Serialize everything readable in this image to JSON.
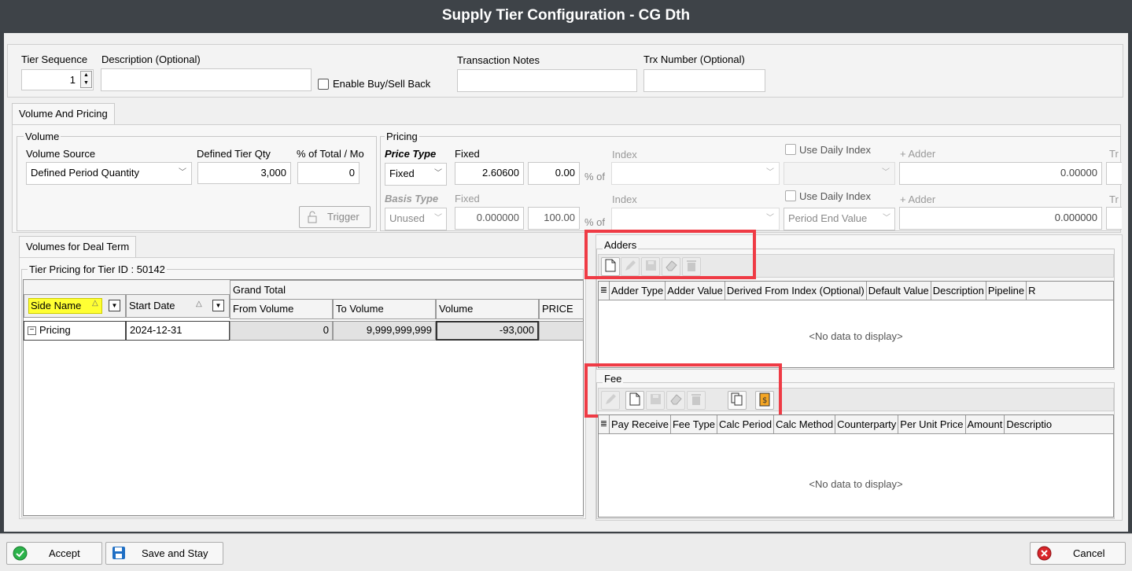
{
  "window": {
    "title": "Supply Tier Configuration - CG Dth"
  },
  "header": {
    "tier_sequence_label": "Tier Sequence",
    "tier_sequence_value": "1",
    "description_label": "Description (Optional)",
    "description_value": "",
    "enable_buy_sell_label": "Enable Buy/Sell Back",
    "transaction_notes_label": "Transaction Notes",
    "transaction_notes_value": "",
    "trx_number_label": "Trx Number (Optional)",
    "trx_number_value": ""
  },
  "tabs": {
    "volume_pricing": "Volume And Pricing",
    "volumes_deal_term": "Volumes for Deal Term"
  },
  "volume": {
    "group_label": "Volume",
    "source_label": "Volume Source",
    "source_value": "Defined Period Quantity",
    "tier_qty_label": "Defined Tier Qty",
    "tier_qty_value": "3,000",
    "pct_total_label": "% of Total / Mo",
    "pct_total_value": "0",
    "trigger_label": "Trigger"
  },
  "pricing": {
    "group_label": "Pricing",
    "price_type_label": "Price Type",
    "price_fixed_label": "Fixed",
    "price_type_value": "Fixed",
    "price_fixed_value": "2.60600",
    "price_pct_value": "0.00",
    "pct_of": "% of",
    "index_label": "Index",
    "use_daily_index_label": "Use Daily Index",
    "adder_label": "+ Adder",
    "price_adder_value": "0.00000",
    "tr_label": "Tr",
    "basis_type_label": "Basis Type",
    "basis_fixed_label": "Fixed",
    "basis_type_value": "Unused",
    "basis_fixed_value": "0.000000",
    "basis_pct_value": "100.00",
    "basis_index_label": "Index",
    "basis_use_daily_index_label": "Use Daily Index",
    "basis_daily_value": "Period End Value",
    "basis_adder_label": "+ Adder",
    "basis_adder_value": "0.000000"
  },
  "tier_grid": {
    "title": "Tier Pricing for Tier ID : 50142",
    "band_label": "Grand Total",
    "columns": {
      "side_name": "Side Name",
      "start_date": "Start Date",
      "from_volume": "From Volume",
      "to_volume": "To Volume",
      "volume": "Volume",
      "price": "PRICE"
    },
    "row": {
      "side_name": "Pricing",
      "start_date": "2024-12-31",
      "from_volume": "0",
      "to_volume": "9,999,999,999",
      "volume": "-93,000",
      "price": ""
    }
  },
  "adders": {
    "title": "Adders",
    "columns": [
      "Adder Type",
      "Adder Value",
      "Derived From Index (Optional)",
      "Default Value",
      "Description",
      "Pipeline",
      "R"
    ],
    "empty_text": "<No data to display>"
  },
  "fee": {
    "title": "Fee",
    "columns": [
      "Pay Receive",
      "Fee Type",
      "Calc Period",
      "Calc Method",
      "Counterparty",
      "Per Unit Price",
      "Amount",
      "Descriptio"
    ],
    "empty_text": "<No data to display>"
  },
  "footer": {
    "accept": "Accept",
    "save_stay": "Save and Stay",
    "cancel": "Cancel"
  },
  "colors": {
    "highlight": "#ef3b45",
    "side_name_header": "#ffff33",
    "titlebar": "#3e4348"
  }
}
